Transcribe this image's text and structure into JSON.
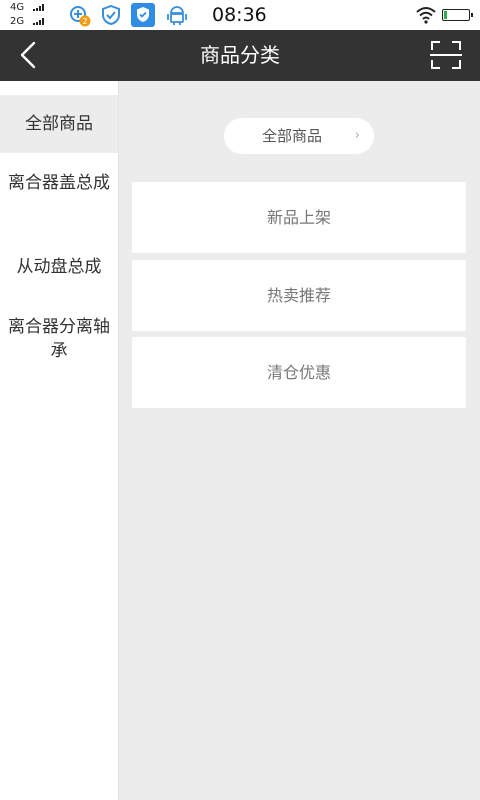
{
  "status_bar": {
    "net1": "4G",
    "net2": "2G",
    "badge_count": "2",
    "time": "08:36"
  },
  "nav": {
    "title": "商品分类"
  },
  "sidebar": {
    "items": [
      {
        "label": "全部商品",
        "active": true
      },
      {
        "label": "离合器盖总成",
        "active": false
      },
      {
        "label": "从动盘总成",
        "active": false
      },
      {
        "label": "离合器分离轴承",
        "active": false
      }
    ]
  },
  "content": {
    "category_pill": "全部商品",
    "cards": [
      {
        "label": "新品上架"
      },
      {
        "label": "热卖推荐"
      },
      {
        "label": "清仓优惠"
      }
    ]
  },
  "colors": {
    "nav_bg": "#333333",
    "page_bg": "#ececec",
    "shield_blue": "#2f8de4"
  },
  "icons": [
    "signal-icon",
    "notification-badge-icon",
    "security-icon",
    "shield-icon",
    "android-icon",
    "wifi-icon",
    "battery-icon",
    "back-arrow-icon",
    "scan-icon",
    "chevron-right-icon"
  ]
}
